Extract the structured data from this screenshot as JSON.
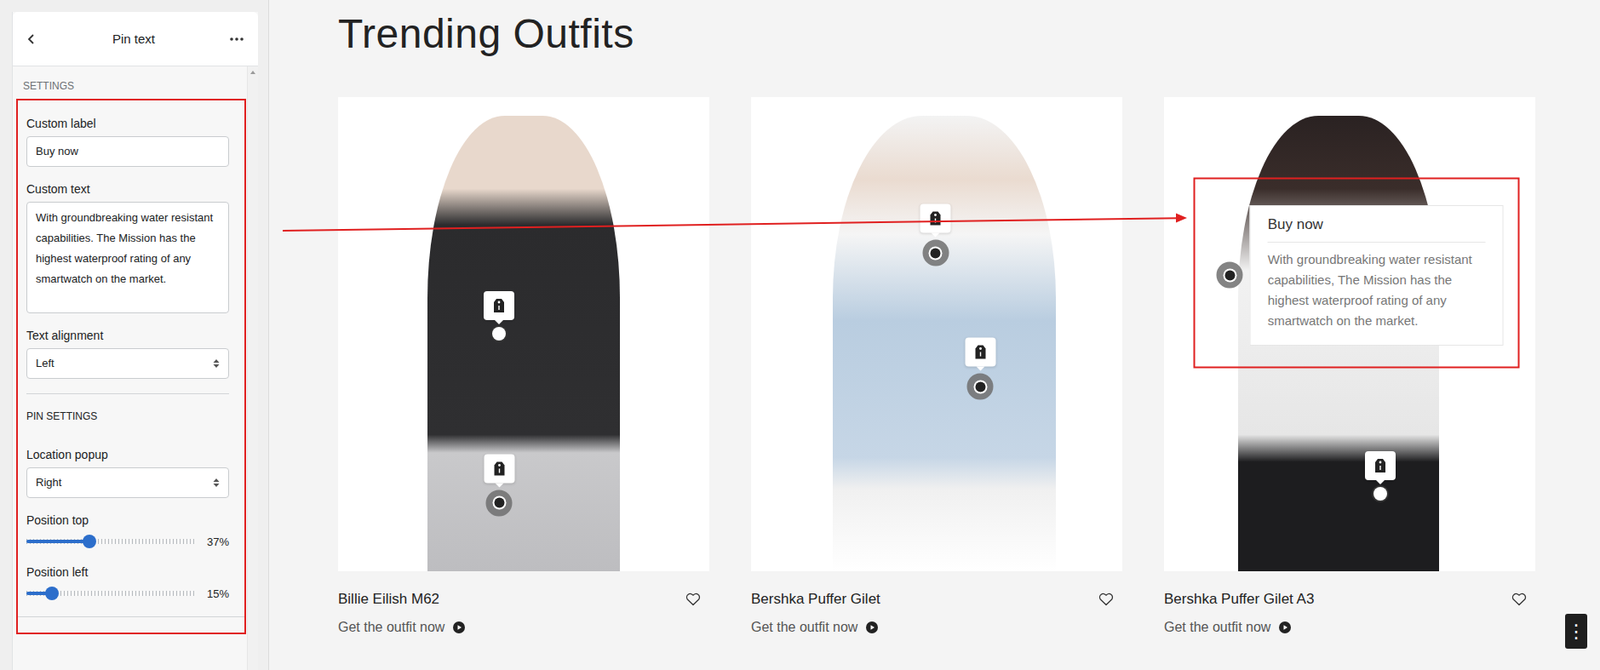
{
  "sidebar": {
    "title": "Pin text",
    "section": "SETTINGS",
    "fields": [
      {
        "kind": "input",
        "label": "Custom label",
        "value": "Buy now"
      },
      {
        "kind": "textarea",
        "label": "Custom text",
        "value": "With groundbreaking water resistant capabilities. The Mission has the highest waterproof rating of any smartwatch on the market."
      },
      {
        "kind": "select",
        "label": "Text alignment",
        "value": "Left"
      }
    ],
    "pin_section": "PIN SETTINGS",
    "pin_fields": [
      {
        "kind": "select",
        "label": "Location popup",
        "value": "Right"
      },
      {
        "kind": "slider",
        "label": "Position top",
        "level": 0.37,
        "reading": "37%"
      },
      {
        "kind": "slider",
        "label": "Position left",
        "level": 0.15,
        "reading": "15%"
      }
    ]
  },
  "page": {
    "title": "Trending Outfits",
    "cards": [
      {
        "name": "Billie Eilish M62",
        "link": "Get the outfit now",
        "favorite": false,
        "pins": [
          {
            "active": false,
            "open": false
          },
          {
            "active": true,
            "open": false
          }
        ]
      },
      {
        "name": "Bershka Puffer Gilet",
        "link": "Get the outfit now",
        "favorite": false,
        "pins": [
          {
            "active": true,
            "open": false
          },
          {
            "active": true,
            "open": false
          }
        ]
      },
      {
        "name": "Bershka Puffer Gilet A3",
        "link": "Get the outfit now",
        "favorite": false,
        "pins": [
          {
            "active": true,
            "open": true,
            "label": "Buy now",
            "text": "With groundbreaking water resistant capabilities, The Mission has the highest waterproof rating of any smartwatch on the market."
          },
          {
            "active": false,
            "open": false
          }
        ]
      }
    ]
  },
  "fab": {
    "icon": "⋮"
  }
}
